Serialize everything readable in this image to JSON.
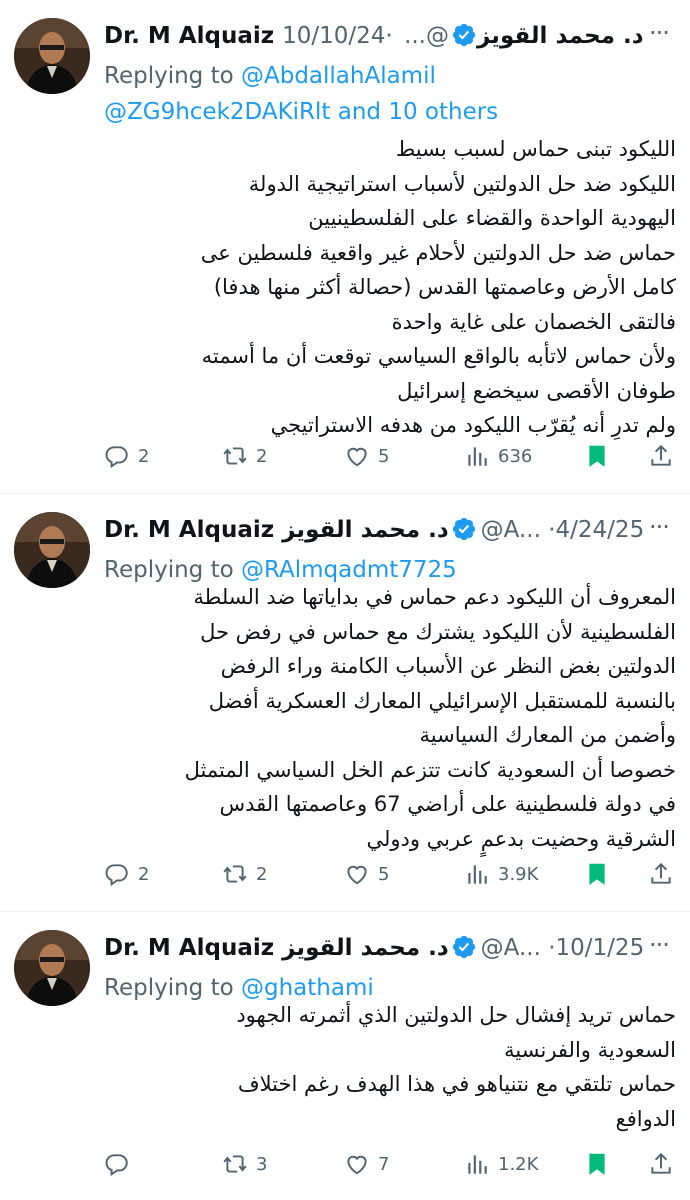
{
  "tweets": [
    {
      "author_name": "Dr. M Alquaiz د. محمد القويز",
      "handle": "@...",
      "separator": "·",
      "date": "10/10/24",
      "more_label": "···",
      "replying_prefix": "Replying to",
      "replying_to": "@AbdallahAlamil",
      "replying_extra": "@ZG9hcek2DAKiRlt and 10 others",
      "lines": [
        "الليكود تبنى حماس لسبب بسيط",
        "الليكود ضد حل الدولتين لأسباب استراتيجية الدولة",
        "اليهودية الواحدة والقضاء على الفلسطينيين",
        "حماس ضد حل الدولتين لأحلام غير واقعية فلسطين عى",
        "كامل الأرض وعاصمتها القدس (حصالة أكثر منها هدفا)",
        "فالتقى الخصمان على غاية واحدة",
        "ولأن حماس لاتأبه بالواقع السياسي توقعت أن ما أسمته",
        "طوفان الأقصى سيخضع إسرائيل",
        "ولم تدرِ أنه يُقرّب الليكود من هدفه الاستراتيجي"
      ],
      "replies": "2",
      "retweets": "2",
      "likes": "5",
      "views": "636"
    },
    {
      "author_name": "Dr. M Alquaiz د. محمد القويز",
      "handle": "@A...",
      "separator": "·",
      "date": "4/24/25",
      "more_label": "···",
      "replying_prefix": "Replying to",
      "replying_to": "@RAlmqadmt7725",
      "replying_extra": "",
      "lines": [
        "المعروف أن الليكود دعم حماس في بداياتها ضد السلطة",
        "الفلسطينية لأن الليكود يشترك مع حماس في رفض حل",
        "الدولتين بغض النظر عن الأسباب الكامنة وراء الرفض",
        "بالنسبة للمستقبل الإسرائيلي المعارك العسكرية أفضل",
        "وأضمن من المعارك السياسية",
        "خصوصا أن السعودية كانت تتزعم الخل السياسي المتمثل",
        "في دولة فلسطينية على أراضي 67 وعاصمتها القدس",
        "الشرقية وحضيت بدعمٍ عربي ودولي"
      ],
      "replies": "2",
      "retweets": "2",
      "likes": "5",
      "views": "3.9K"
    },
    {
      "author_name": "Dr. M Alquaiz د. محمد القويز",
      "handle": "@A...",
      "separator": "·",
      "date": "10/1/25",
      "more_label": "···",
      "replying_prefix": "Replying to",
      "replying_to": "@ghathami",
      "replying_extra": "",
      "lines": [
        "حماس تريد إفشال حل الدولتين الذي أثمرته الجهود",
        "السعودية والفرنسية",
        "حماس تلتقي مع نتنياهو في هذا الهدف رغم اختلاف",
        "الدوافع"
      ],
      "replies": "",
      "retweets": "3",
      "likes": "7",
      "views": "1.2K"
    }
  ],
  "icons": {
    "reply": "reply-icon",
    "retweet": "retweet-icon",
    "like": "heart-icon",
    "views": "views-icon",
    "bookmark": "bookmark-icon",
    "share": "share-icon",
    "verified": "verified-badge-icon"
  },
  "colors": {
    "text": "#0f1419",
    "secondary": "#536471",
    "link": "#1d9bf0",
    "verified": "#1d9bf0",
    "bookmark": "#00ba7c"
  }
}
